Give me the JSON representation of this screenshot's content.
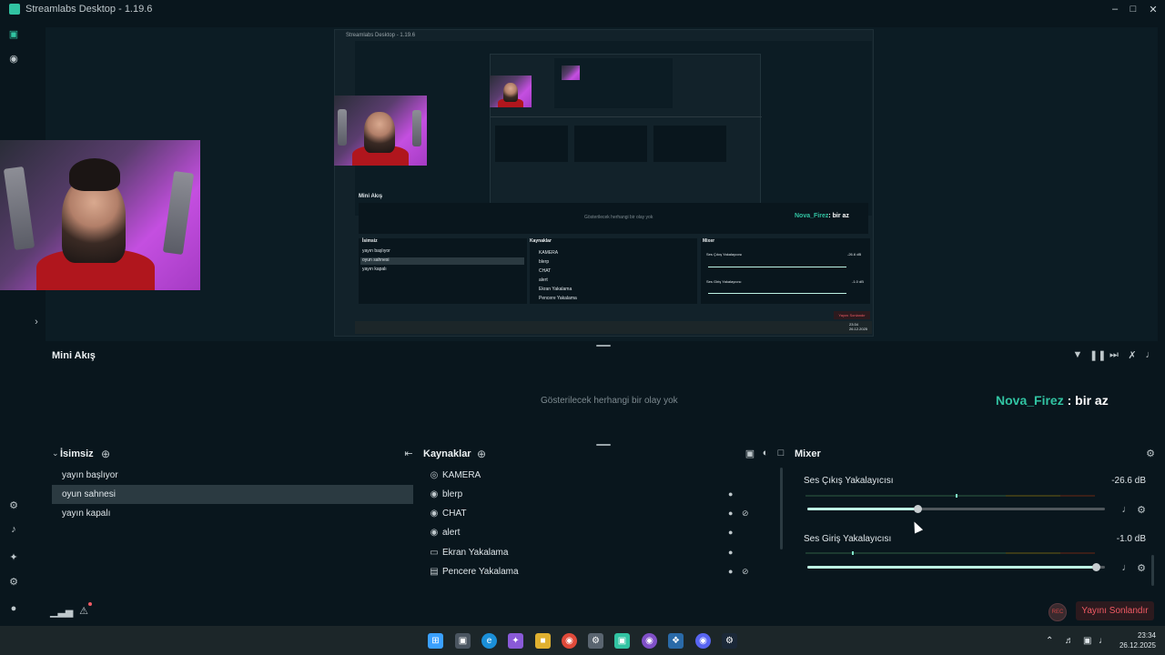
{
  "window": {
    "title": "Streamlabs Desktop - 1.19.6"
  },
  "nested_preview": {
    "title": "Streamlabs Desktop - 1.19.6",
    "mini_akis": "Mini Akış",
    "empty": "Gösterilecek herhangi bir olay yok",
    "chat_user": "Nova_Firez",
    "chat_text": ": bir az",
    "scenes_header": "İsimsiz",
    "scenes": [
      "yayın başlıyor",
      "oyun sahnesi",
      "yayın kapalı"
    ],
    "sources_header": "Kaynaklar",
    "sources": [
      "KAMERA",
      "blerp",
      "CHAT",
      "alert",
      "Ekran Yakalama",
      "Pencere Yakalama"
    ],
    "mixer_header": "Mixer",
    "mixer": [
      {
        "label": "Ses Çıkış Yakalayıcısı",
        "db": "-26.6 dB"
      },
      {
        "label": "Ses Giriş Yakalayıcısı",
        "db": "-1.0 dB"
      }
    ],
    "end_stream": "Yayını Sonlandır",
    "time": "23:34",
    "date": "26.12.2025"
  },
  "mini_akis": {
    "title": "Mini Akış",
    "empty_message": "Gösterilecek herhangi bir olay yok",
    "chat_user": "Nova_Firez",
    "chat_text": " : bir az"
  },
  "scenes": {
    "header": "İsimsiz",
    "items": [
      {
        "label": "yayın başlıyor",
        "active": false
      },
      {
        "label": "oyun sahnesi",
        "active": true
      },
      {
        "label": "yayın kapalı",
        "active": false
      }
    ]
  },
  "sources": {
    "header": "Kaynaklar",
    "items": [
      {
        "label": "KAMERA",
        "icon": "webcam-icon",
        "lock": false,
        "eye_hidden": false
      },
      {
        "label": "blerp",
        "icon": "globe-icon",
        "lock": true,
        "eye_hidden": false
      },
      {
        "label": "CHAT",
        "icon": "globe-icon",
        "lock": true,
        "eye_hidden": true
      },
      {
        "label": "alert",
        "icon": "globe-icon",
        "lock": true,
        "eye_hidden": false
      },
      {
        "label": "Ekran Yakalama",
        "icon": "monitor-icon",
        "lock": true,
        "eye_hidden": false
      },
      {
        "label": "Pencere Yakalama",
        "icon": "window-icon",
        "lock": true,
        "eye_hidden": true
      }
    ]
  },
  "mixer": {
    "header": "Mixer",
    "channels": [
      {
        "label": "Ses Çıkış Yakalayıcısı",
        "db": "-26.6 dB",
        "level": 0.37,
        "peak": 0.52
      },
      {
        "label": "Ses Giriş Yakalayıcısı",
        "db": "-1.0 dB",
        "level": 0.97,
        "peak": 0.16
      }
    ]
  },
  "footer": {
    "rec_label": "REC",
    "end_stream": "Yayını Sonlandır"
  },
  "taskbar": {
    "time": "23:34",
    "date": "26.12.2025"
  },
  "colors": {
    "accent": "#31c3a2",
    "background": "#09161d",
    "panel": "#0c1c24",
    "danger": "#f05a64"
  }
}
